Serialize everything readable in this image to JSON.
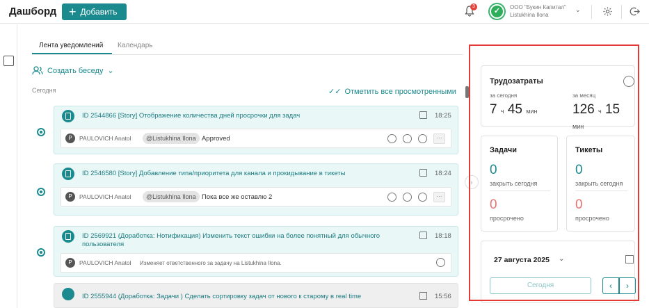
{
  "header": {
    "title": "Дашборд",
    "add_label": "Добавить",
    "notif_count": "3",
    "user_initial": "✓",
    "company": "ООО \"Букин Капитал\"",
    "user": "Listukhina Ilona"
  },
  "tabs": [
    {
      "label": "Лента уведомлений"
    },
    {
      "label": "Календарь"
    }
  ],
  "feed": {
    "create_chat": "Создать беседу",
    "today": "Сегодня",
    "mark_all": "Отметить все просмотренными",
    "items": [
      {
        "title": "ID 2544866 [Story] Отображение количества дней просрочки для задач",
        "time": "18:25",
        "author": "PAULOVICH Anatol",
        "mention": "@Listukhina Ilona",
        "message": "Approved"
      },
      {
        "title": "ID 2546580 [Story] Добавление типа/приоритета для канала и прокидывание в тикеты",
        "time": "18:24",
        "author": "PAULOVICH Anatol",
        "mention": "@Listukhina Ilona",
        "message": "Пока все же оставлю 2"
      },
      {
        "title": "ID 2569921 (Доработка: Нотификация) Изменить текст ошибки на более понятный для обычного пользователя",
        "time": "18:18",
        "author": "PAULOVICH Anatol",
        "message": "Изменяет ответственного за задачу на Listukhina Ilona."
      },
      {
        "title": "ID 2555944 (Доработка: Задачи ) Сделать сортировку задач от нового к старому в real time",
        "time": "15:56"
      }
    ]
  },
  "widgets": {
    "labor": {
      "title": "Трудозатраты",
      "today_label": "за сегодня",
      "month_label": "за месяц",
      "today_h": "7",
      "today_m": "45",
      "month_h": "126",
      "month_m": "15",
      "h_unit": "ч",
      "m_unit": "мин"
    },
    "tasks": {
      "title": "Задачи",
      "close_today": "0",
      "close_today_label": "закрыть сегодня",
      "overdue": "0",
      "overdue_label": "просрочено"
    },
    "tickets": {
      "title": "Тикеты",
      "close_today": "0",
      "close_today_label": "закрыть сегодня",
      "overdue": "0",
      "overdue_label": "просрочено"
    },
    "calendar": {
      "date": "27 августа 2025",
      "today_btn": "Сегодня"
    }
  },
  "colors": {
    "accent": "#1b8a8e",
    "danger": "#e0423a",
    "highlight_border": "#e53935"
  }
}
